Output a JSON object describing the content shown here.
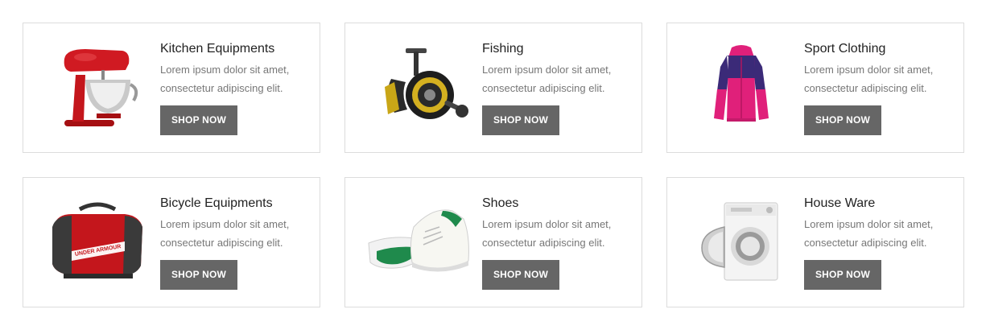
{
  "button_label": "SHOP NOW",
  "bag_brand_text": "UNDER ARMOUR",
  "colors": {
    "button_bg": "#666666",
    "button_text": "#ffffff",
    "card_border": "#dcdcdc",
    "title_text": "#222222",
    "desc_text": "#777777"
  },
  "cards": [
    {
      "title": "Kitchen Equipments",
      "desc_line1": "Lorem ipsum dolor sit amet,",
      "desc_line2": "consectetur adipiscing elit.",
      "image": "stand-mixer"
    },
    {
      "title": "Fishing",
      "desc_line1": "Lorem ipsum dolor sit amet,",
      "desc_line2": "consectetur adipiscing elit.",
      "image": "fishing-reel"
    },
    {
      "title": "Sport Clothing",
      "desc_line1": "Lorem ipsum dolor sit amet,",
      "desc_line2": "consectetur adipiscing elit.",
      "image": "sport-jacket"
    },
    {
      "title": "Bicycle Equipments",
      "desc_line1": "Lorem ipsum dolor sit amet,",
      "desc_line2": "consectetur adipiscing elit.",
      "image": "duffel-bag"
    },
    {
      "title": "Shoes",
      "desc_line1": "Lorem ipsum dolor sit amet,",
      "desc_line2": "consectetur adipiscing elit.",
      "image": "sneakers"
    },
    {
      "title": "House Ware",
      "desc_line1": "Lorem ipsum dolor sit amet,",
      "desc_line2": "consectetur adipiscing elit.",
      "image": "washing-machine"
    }
  ]
}
